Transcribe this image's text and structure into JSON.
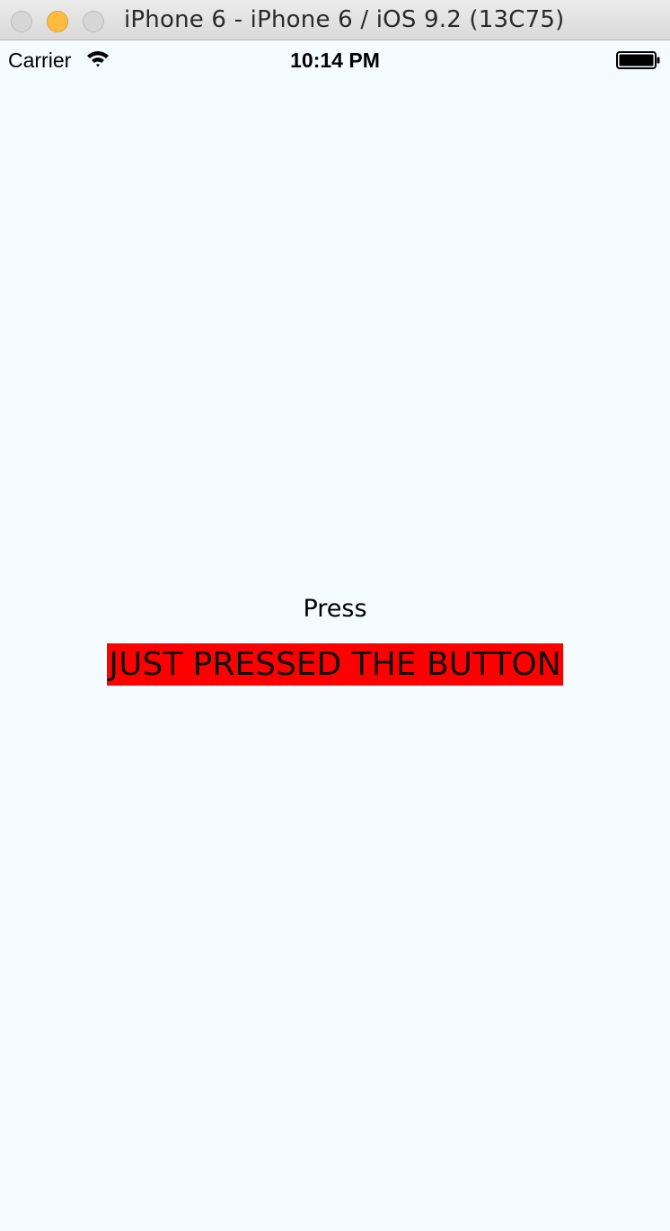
{
  "window": {
    "title": "iPhone 6 - iPhone 6 / iOS 9.2 (13C75)"
  },
  "statusbar": {
    "carrier": "Carrier",
    "time": "10:14 PM",
    "wifi_icon": "wifi-icon",
    "battery_icon": "battery-full-icon"
  },
  "app": {
    "button_label": "Press",
    "status_text": "JUST PRESSED THE BUTTON"
  },
  "colors": {
    "background": "#f5fcff",
    "label_highlight": "#ff0000",
    "minimize_button": "#fdbc40"
  }
}
